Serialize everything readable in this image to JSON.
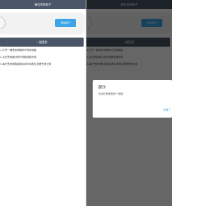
{
  "header": {
    "title": "微信签到助手"
  },
  "card": {
    "action_label": "添加用户"
  },
  "main_button": {
    "label": "一键签到"
  },
  "steps": [
    "1.打开一键签到领取即可签到奖励",
    "2.点击签到每日即可领取奖励完成",
    "3.每日签到领取奖励后请手动前往查看签到记录"
  ],
  "dialog": {
    "title": "提示",
    "message": "今天已完成签到一次啦！",
    "ok_label": "知道了"
  },
  "colors": {
    "header_bg": "#4a5567",
    "accent": "#3ba5e8",
    "overlay": "rgba(0,0,0,0.6)"
  }
}
